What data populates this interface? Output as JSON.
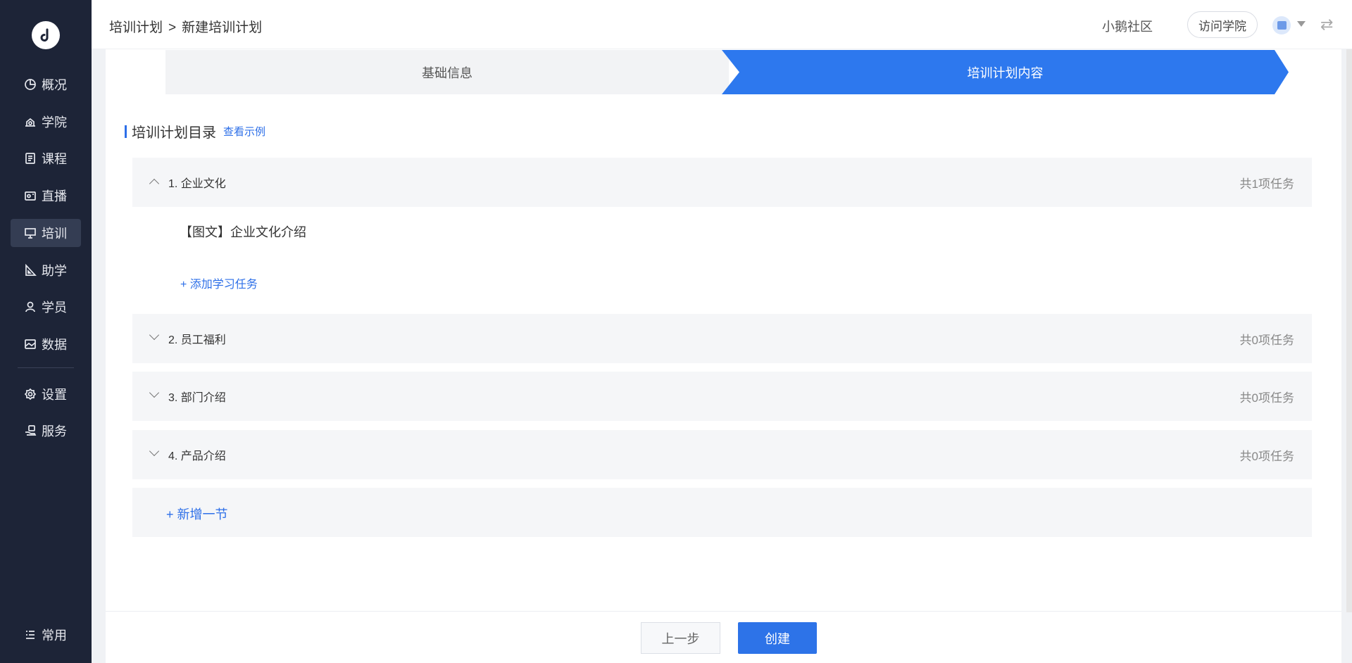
{
  "sidebar": {
    "logo_icon": "logo-music-note-icon",
    "items": [
      {
        "label": "概况",
        "icon": "pie-chart-icon"
      },
      {
        "label": "学院",
        "icon": "academy-icon"
      },
      {
        "label": "课程",
        "icon": "course-doc-icon"
      },
      {
        "label": "直播",
        "icon": "live-camera-icon"
      },
      {
        "label": "培训",
        "icon": "training-board-icon",
        "active": true
      },
      {
        "label": "助学",
        "icon": "ruler-triangle-icon"
      },
      {
        "label": "学员",
        "icon": "user-icon"
      },
      {
        "label": "数据",
        "icon": "data-image-icon"
      },
      {
        "label": "设置",
        "icon": "gear-icon"
      },
      {
        "label": "服务",
        "icon": "service-hand-icon"
      },
      {
        "label": "常用",
        "icon": "list-icon"
      }
    ]
  },
  "header": {
    "breadcrumb": [
      "培训计划",
      ">",
      "新建培训计划"
    ],
    "community": "小鹅社区",
    "visit_button": "访问学院"
  },
  "steps": {
    "step1": "基础信息",
    "step2": "培训计划内容"
  },
  "catalog": {
    "title": "培训计划目录",
    "example_link": "查看示例",
    "chapters": [
      {
        "title": "1. 企业文化",
        "count": "共1项任务",
        "expanded": true
      },
      {
        "title": "2. 员工福利",
        "count": "共0项任务",
        "expanded": false
      },
      {
        "title": "3. 部门介绍",
        "count": "共0项任务",
        "expanded": false
      },
      {
        "title": "4. 产品介绍",
        "count": "共0项任务",
        "expanded": false
      }
    ],
    "task": "【图文】企业文化介绍",
    "add_task": "+ 添加学习任务",
    "add_section": "+ 新增一节"
  },
  "footer": {
    "prev_button": "上一步",
    "create_button": "创建"
  },
  "colors": {
    "sidebar_bg": "#1d2437",
    "primary": "#2d73e8",
    "step_active": "#2d78ee"
  }
}
